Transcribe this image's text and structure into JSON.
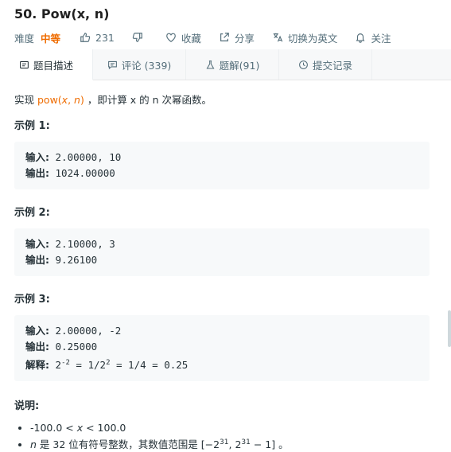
{
  "problem": {
    "title": "50. Pow(x, n)",
    "difficulty_label": "难度",
    "difficulty": "中等",
    "likes": "231",
    "favorite": "收藏",
    "share": "分享",
    "switch_lang": "切换为英文",
    "follow": "关注"
  },
  "tabs": [
    {
      "label": "题目描述"
    },
    {
      "label": "评论 (339)"
    },
    {
      "label": "题解(91)"
    },
    {
      "label": "提交记录"
    }
  ],
  "description": {
    "prefix": "实现 ",
    "func_name": "pow(",
    "func_x": "x",
    "func_sep": ", ",
    "func_n": "n",
    "func_close": ")",
    "suffix": " ，即计算 x 的 n 次幂函数。"
  },
  "examples": [
    {
      "title": "示例 1:",
      "input_label": "输入:",
      "input": " 2.00000, 10",
      "output_label": "输出:",
      "output": " 1024.00000"
    },
    {
      "title": "示例 2:",
      "input_label": "输入:",
      "input": " 2.10000, 3",
      "output_label": "输出:",
      "output": " 9.26100"
    },
    {
      "title": "示例 3:",
      "input_label": "输入:",
      "input": " 2.00000, -2",
      "output_label": "输出:",
      "output": " 0.25000",
      "explain_label": "解释:",
      "explain_a": " 2",
      "explain_exp1": "-2",
      "explain_b": " = 1/2",
      "explain_exp2": "2",
      "explain_c": " = 1/4 = 0.25"
    }
  ],
  "notes": {
    "title": "说明:",
    "item1_a": "-100.0 < ",
    "item1_x": "x",
    "item1_b": " < 100.0",
    "item2_n": "n",
    "item2_a": " 是 32 位有符号整数，其数值范围是 [−2",
    "item2_exp1": "31",
    "item2_b": ", 2",
    "item2_exp2": "31",
    "item2_c": " − 1] 。"
  },
  "colors": {
    "accent": "#ef6c00",
    "code_bg": "#f7f9fa",
    "tab_bg": "#f7f8f9"
  }
}
